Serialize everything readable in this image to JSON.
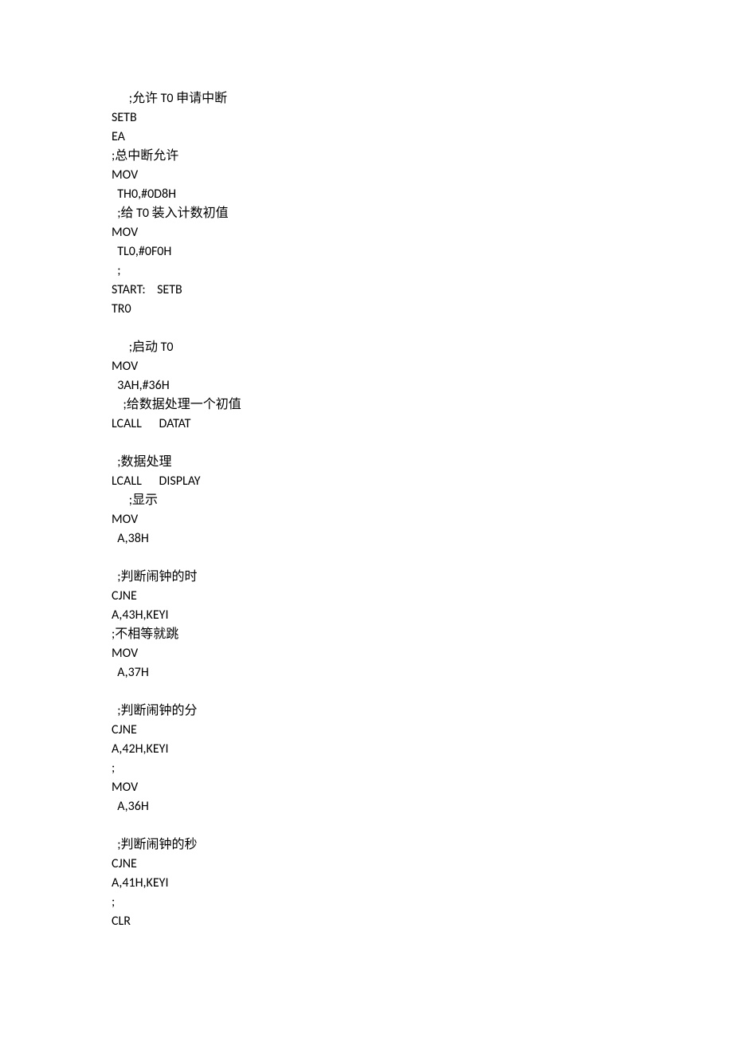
{
  "lines": [
    "      ;允许 T0 申请中断",
    "SETB ",
    "EA  ",
    ";总中断允许",
    "MOV ",
    "  TH0,#0D8H ",
    "  ;给 T0 装入计数初值",
    "MOV ",
    "  TL0,#0F0H ",
    "  ;    ",
    "START:    SETB",
    "TR0",
    "",
    "      ;启动 T0",
    "MOV ",
    "  3AH,#36H  ",
    "    ;给数据处理一个初值",
    "LCALL      DATAT",
    "",
    "  ;数据处理",
    "LCALL      DISPLAY",
    "      ;显示",
    "MOV ",
    "  A,38H ",
    "",
    "  ;判断闹钟的时",
    "CJNE  ",
    "A,43H,KEYI",
    ";不相等就跳",
    "MOV ",
    "  A,37H ",
    "",
    "  ;判断闹钟的分",
    "CJNE  ",
    "A,42H,KEYI",
    ";",
    "MOV ",
    "  A,36H ",
    "",
    "  ;判断闹钟的秒",
    "CJNE  ",
    "A,41H,KEYI",
    ";",
    "CLR"
  ]
}
